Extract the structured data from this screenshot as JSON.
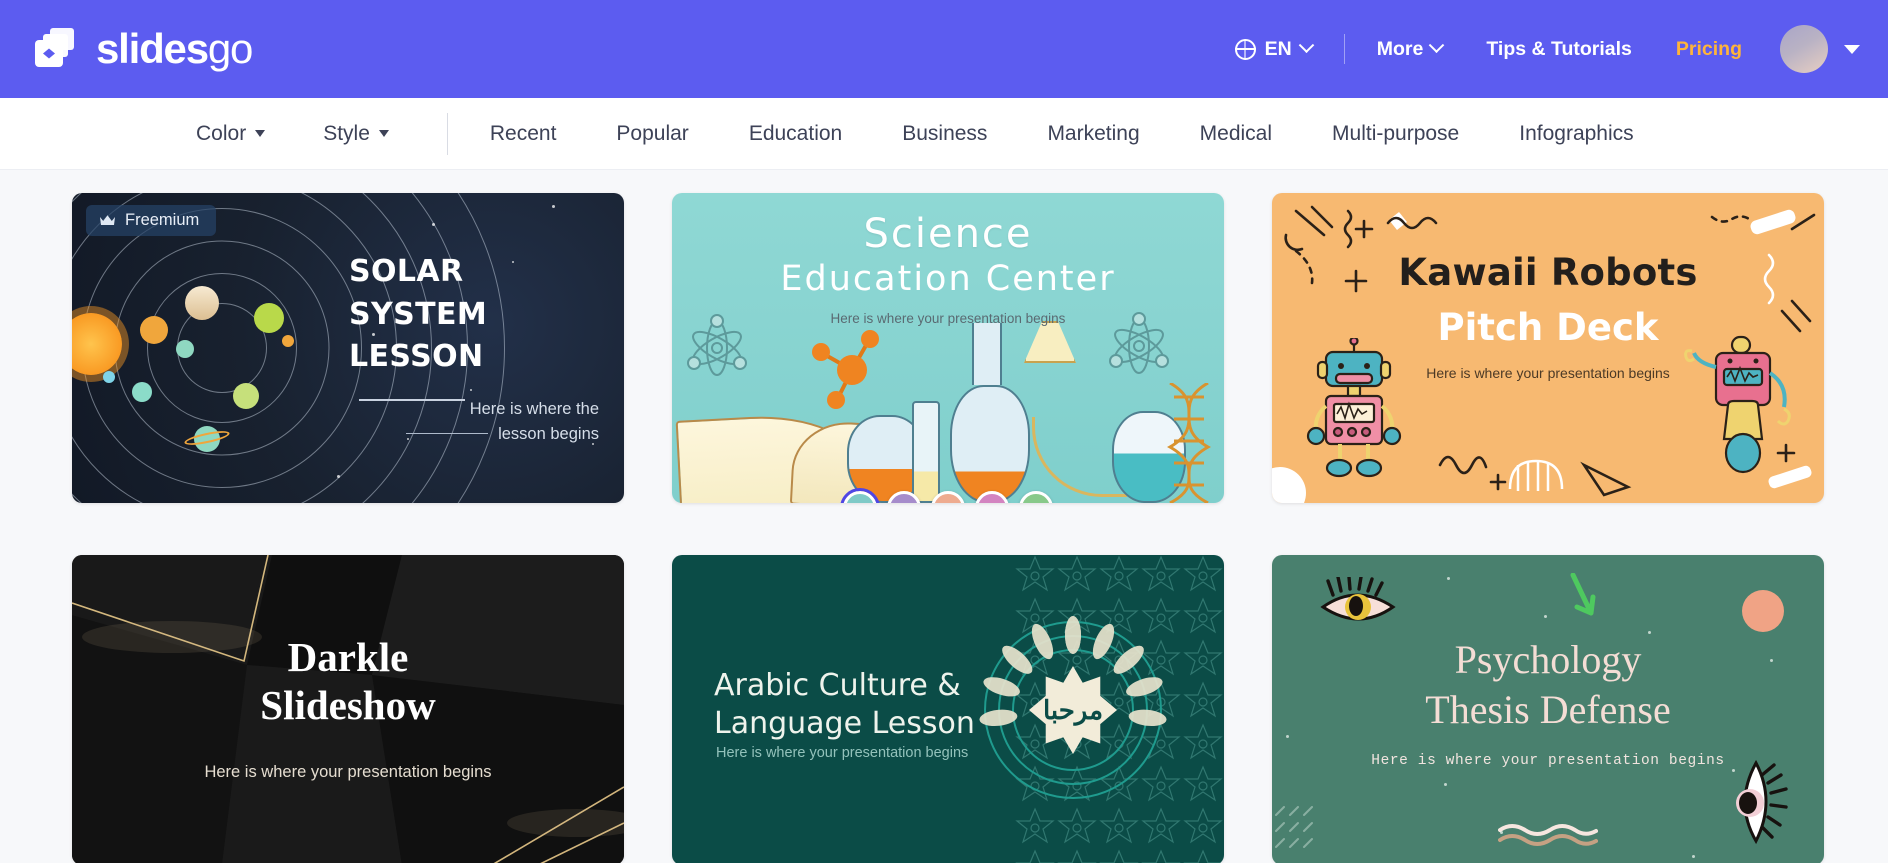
{
  "header": {
    "logo_text_bold": "slides",
    "logo_text_light": "go",
    "logo_icon": "slides-stack-icon",
    "language": "EN",
    "language_icon": "globe-icon",
    "more": "More",
    "tips": "Tips & Tutorials",
    "pricing": "Pricing",
    "avatar_icon": "user-avatar",
    "accent_purple": "#5c5cf0",
    "pricing_color": "#ffb43a"
  },
  "subnav": {
    "filters": [
      {
        "label": "Color",
        "icon": "chevron-down-icon"
      },
      {
        "label": "Style",
        "icon": "chevron-down-icon"
      }
    ],
    "categories": [
      "Recent",
      "Popular",
      "Education",
      "Business",
      "Marketing",
      "Medical",
      "Multi-purpose",
      "Infographics"
    ]
  },
  "cards": [
    {
      "id": "solar-system-lesson",
      "badge": "Freemium",
      "badge_icon": "crown-icon",
      "title_line1": "SOLAR SYSTEM",
      "title_line2": "LESSON",
      "subtitle_line1": "Here is where the",
      "subtitle_line2": "lesson begins"
    },
    {
      "id": "science-education-center",
      "title_line1": "Science",
      "title_line2": "Education Center",
      "subtitle": "Here is where your presentation begins",
      "swatches": [
        {
          "name": "teal",
          "color": "#7fcac7",
          "active": true
        },
        {
          "name": "purple",
          "color": "#a68ccb",
          "active": false
        },
        {
          "name": "peach",
          "color": "#eeab8f",
          "active": false
        },
        {
          "name": "pink",
          "color": "#d384c0",
          "active": false
        },
        {
          "name": "green",
          "color": "#88c98a",
          "active": false
        }
      ]
    },
    {
      "id": "kawaii-robots-pitch-deck",
      "title_line1": "Kawaii Robots",
      "title_line2": "Pitch Deck",
      "subtitle": "Here is where your presentation begins"
    },
    {
      "id": "darkle-slideshow",
      "title_line1": "Darkle",
      "title_line2": "Slideshow",
      "subtitle": "Here is where your presentation begins"
    },
    {
      "id": "arabic-culture-language-lesson",
      "title_line1": "Arabic Culture &",
      "title_line2": "Language Lesson",
      "subtitle": "Here is where your presentation begins",
      "badge_text": "مرحبا"
    },
    {
      "id": "psychology-thesis-defense",
      "title_line1": "Psychology",
      "title_line2": "Thesis Defense",
      "subtitle": "Here is where your presentation begins"
    }
  ]
}
